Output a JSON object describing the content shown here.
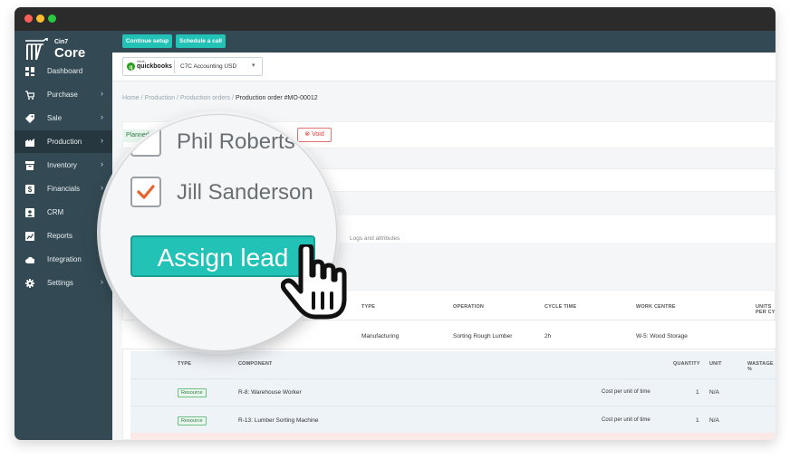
{
  "brand": {
    "small": "Cin7",
    "big": "Core"
  },
  "sidebar": {
    "items": [
      {
        "label": "Dashboard",
        "icon": "dashboard-icon",
        "chevron": false
      },
      {
        "label": "Purchase",
        "icon": "cart-icon",
        "chevron": true
      },
      {
        "label": "Sale",
        "icon": "tag-icon",
        "chevron": true
      },
      {
        "label": "Production",
        "icon": "factory-icon",
        "chevron": true,
        "active": true
      },
      {
        "label": "Inventory",
        "icon": "inventory-icon",
        "chevron": true
      },
      {
        "label": "Financials",
        "icon": "dollar-icon",
        "chevron": true
      },
      {
        "label": "CRM",
        "icon": "contact-icon",
        "chevron": false
      },
      {
        "label": "Reports",
        "icon": "chart-icon",
        "chevron": false
      },
      {
        "label": "Integration",
        "icon": "cloud-icon",
        "chevron": false
      },
      {
        "label": "Settings",
        "icon": "gear-icon",
        "chevron": true
      }
    ]
  },
  "topbar": {
    "continue_label": "Continue setup",
    "schedule_label": "Schedule a call"
  },
  "account": {
    "qb_small": "intuit",
    "qb_big": "quickbooks",
    "selected": "C7C Accounting USD"
  },
  "breadcrumb": {
    "home": "Home",
    "production": "Production",
    "orders": "Production orders",
    "current": "Production order #MO-00012"
  },
  "order": {
    "status": "Planned",
    "number_fragment": "12",
    "void_label": "Void"
  },
  "tabs": {
    "logs": "Logs and attributes"
  },
  "steps_table": {
    "headers": [
      "TYPE",
      "OPERATION",
      "CYCLE TIME",
      "WORK CENTRE",
      "UNITS PER CY"
    ],
    "row": [
      "Manufacturing",
      "Sorting Rough Lumber",
      "2h",
      "W-5: Wood Storage"
    ]
  },
  "components_table": {
    "headers": [
      "TYPE",
      "COMPONENT",
      "QUANTITY",
      "UNIT",
      "WASTAGE %"
    ],
    "rows": [
      {
        "type": "Resource",
        "component": "R-8: Warehouse Worker",
        "cost": "Cost per unit of time",
        "qty": "1",
        "unit": "N/A"
      },
      {
        "type": "Resource",
        "component": "R-13: Lumber Sorting Machine",
        "cost": "Cost per unit of time",
        "qty": "1",
        "unit": "N/A"
      }
    ]
  },
  "magnifier": {
    "names": [
      "Phil Roberts",
      "Jill Sanderson"
    ],
    "checked": [
      false,
      true
    ],
    "assign_label": "Assign lead"
  },
  "colors": {
    "sidebar": "#334a54",
    "accent": "#22c3b6",
    "check": "#e8622c"
  }
}
